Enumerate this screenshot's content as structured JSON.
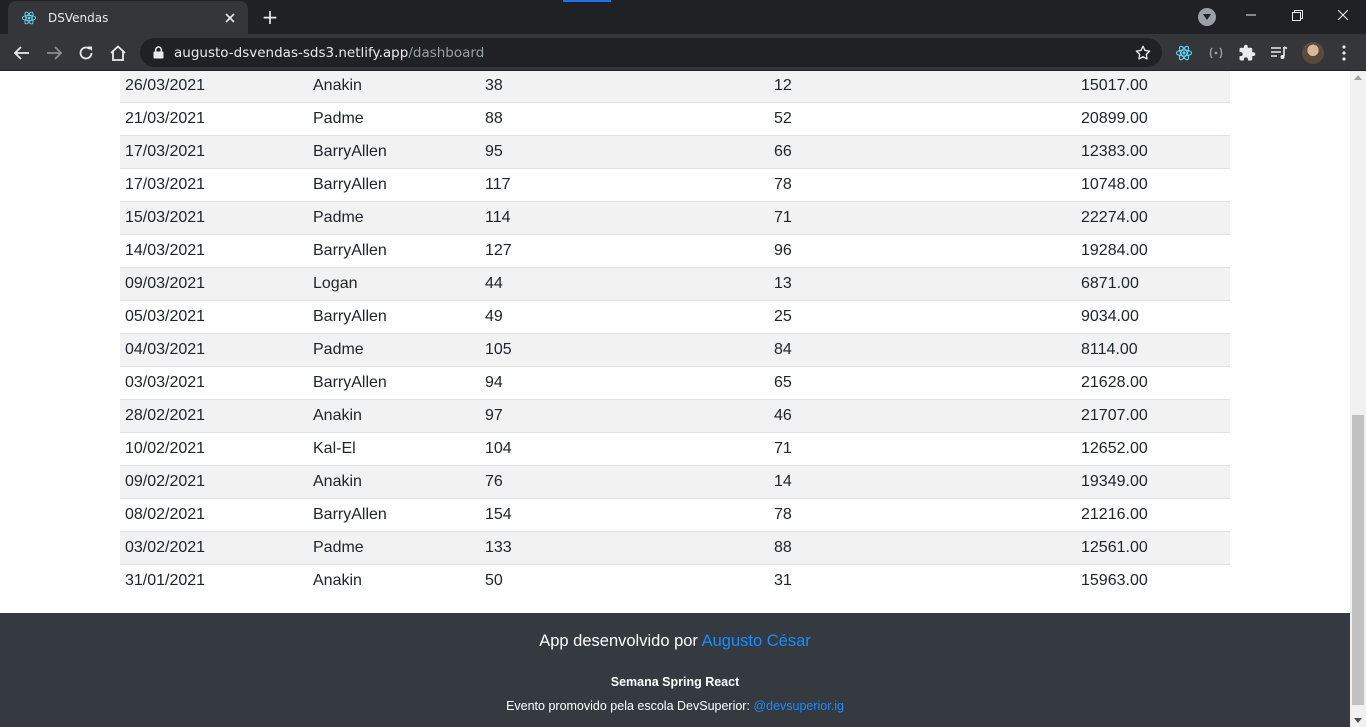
{
  "browser": {
    "tab": {
      "title": "DSVendas",
      "favicon": "react-icon"
    },
    "new_tab_label": "+",
    "address": {
      "host": "augusto-dsvendas-sds3.netlify.app",
      "path": "/dashboard"
    },
    "window_controls": {
      "minimize": "—",
      "restore": "❐",
      "close": "✕"
    },
    "colors": {
      "tabstrip": "#202124",
      "toolbar": "#35363a",
      "text": "#e8eaed",
      "accent": "#1a73e8"
    }
  },
  "sales": {
    "rows": [
      {
        "date": "26/03/2021",
        "seller": "Anakin",
        "visited": "38",
        "deals": "12",
        "amount": "15017.00"
      },
      {
        "date": "21/03/2021",
        "seller": "Padme",
        "visited": "88",
        "deals": "52",
        "amount": "20899.00"
      },
      {
        "date": "17/03/2021",
        "seller": "BarryAllen",
        "visited": "95",
        "deals": "66",
        "amount": "12383.00"
      },
      {
        "date": "17/03/2021",
        "seller": "BarryAllen",
        "visited": "117",
        "deals": "78",
        "amount": "10748.00"
      },
      {
        "date": "15/03/2021",
        "seller": "Padme",
        "visited": "114",
        "deals": "71",
        "amount": "22274.00"
      },
      {
        "date": "14/03/2021",
        "seller": "BarryAllen",
        "visited": "127",
        "deals": "96",
        "amount": "19284.00"
      },
      {
        "date": "09/03/2021",
        "seller": "Logan",
        "visited": "44",
        "deals": "13",
        "amount": "6871.00"
      },
      {
        "date": "05/03/2021",
        "seller": "BarryAllen",
        "visited": "49",
        "deals": "25",
        "amount": "9034.00"
      },
      {
        "date": "04/03/2021",
        "seller": "Padme",
        "visited": "105",
        "deals": "84",
        "amount": "8114.00"
      },
      {
        "date": "03/03/2021",
        "seller": "BarryAllen",
        "visited": "94",
        "deals": "65",
        "amount": "21628.00"
      },
      {
        "date": "28/02/2021",
        "seller": "Anakin",
        "visited": "97",
        "deals": "46",
        "amount": "21707.00"
      },
      {
        "date": "10/02/2021",
        "seller": "Kal-El",
        "visited": "104",
        "deals": "71",
        "amount": "12652.00"
      },
      {
        "date": "09/02/2021",
        "seller": "Anakin",
        "visited": "76",
        "deals": "14",
        "amount": "19349.00"
      },
      {
        "date": "08/02/2021",
        "seller": "BarryAllen",
        "visited": "154",
        "deals": "78",
        "amount": "21216.00"
      },
      {
        "date": "03/02/2021",
        "seller": "Padme",
        "visited": "133",
        "deals": "88",
        "amount": "12561.00"
      },
      {
        "date": "31/01/2021",
        "seller": "Anakin",
        "visited": "50",
        "deals": "31",
        "amount": "15963.00"
      }
    ]
  },
  "footer": {
    "prefix": "App desenvolvido por ",
    "author": "Augusto César",
    "event": "Semana Spring React",
    "promo_prefix": "Evento promovido pela escola DevSuperior: ",
    "promo_link": "@devsuperior.ig",
    "colors": {
      "background": "#343a40",
      "link": "#1a8cff"
    }
  }
}
